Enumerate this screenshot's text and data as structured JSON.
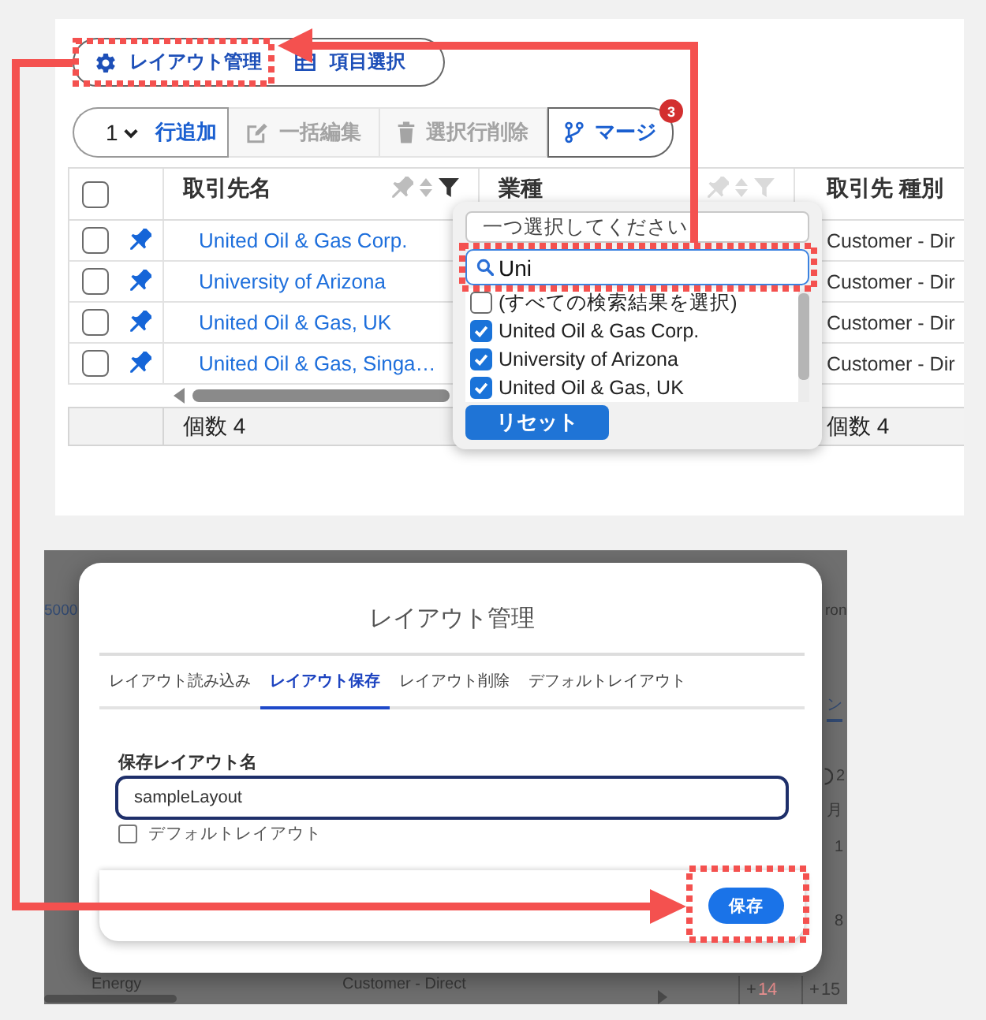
{
  "top_screen": {
    "view_buttons": [
      {
        "label": "レイアウト管理",
        "kind": "layout"
      },
      {
        "label": "項目選択",
        "kind": "columns"
      }
    ],
    "toolbar": {
      "add_count": "1",
      "buttons": [
        {
          "label": "行追加",
          "kind": "add",
          "disabled": false
        },
        {
          "label": "一括編集",
          "kind": "edit",
          "disabled": true
        },
        {
          "label": "選択行削除",
          "kind": "delete",
          "disabled": true
        },
        {
          "label": "マージ",
          "kind": "merge",
          "disabled": false,
          "badge": "3"
        }
      ]
    },
    "table": {
      "select_all_checked": false,
      "columns": [
        {
          "label": "取引先名",
          "filtered": true
        },
        {
          "label": "業種",
          "filtered": false
        },
        {
          "label": "取引先 種別"
        }
      ],
      "rows": [
        {
          "checked": false,
          "pinned": true,
          "account_name": "United Oil & Gas Corp.",
          "account_type": "Customer - Dir"
        },
        {
          "checked": false,
          "pinned": true,
          "account_name": "University of Arizona",
          "account_type": "Customer - Dir"
        },
        {
          "checked": false,
          "pinned": true,
          "account_name": "United Oil & Gas, UK",
          "account_type": "Customer - Dir"
        },
        {
          "checked": false,
          "pinned": true,
          "account_name": "United Oil & Gas, Singa…",
          "account_type": "Customer - Dir"
        }
      ],
      "footer": {
        "account_name": "個数 4",
        "account_type": "個数 4"
      }
    },
    "filter_popup": {
      "select": {
        "placeholder": "一つ選択してください"
      },
      "search": {
        "value": "Uni"
      },
      "options": [
        {
          "label": "(すべての検索結果を選択)",
          "checked": false
        },
        {
          "label": "United Oil & Gas Corp.",
          "checked": true
        },
        {
          "label": "University of Arizona",
          "checked": true
        },
        {
          "label": "United Oil & Gas, UK",
          "checked": true
        }
      ],
      "reset_label": "リセット"
    }
  },
  "bottom_screen": {
    "background": {
      "texts": [
        {
          "text": "5000",
          "kind": "link"
        },
        {
          "text": "ron",
          "kind": "plain"
        },
        {
          "text": "ン",
          "kind": "tab"
        },
        {
          "text": "2",
          "kind": "plain"
        },
        {
          "text": "月",
          "kind": "plain"
        },
        {
          "text": "1",
          "kind": "plain"
        },
        {
          "text": "8",
          "kind": "plain"
        },
        {
          "text": "Energy",
          "kind": "plain"
        },
        {
          "text": "Customer - Direct",
          "kind": "plain"
        }
      ],
      "cells": [
        {
          "sign": "+",
          "number": "14",
          "color": "#f29494"
        },
        {
          "sign": "+",
          "number": "15",
          "color": "#3c3c3c"
        }
      ]
    },
    "modal": {
      "title": "レイアウト管理",
      "tabs": [
        {
          "label": "レイアウト読み込み",
          "selected": false
        },
        {
          "label": "レイアウト保存",
          "selected": true
        },
        {
          "label": "レイアウト削除",
          "selected": false
        },
        {
          "label": "デフォルトレイアウト",
          "selected": false
        }
      ],
      "name_field": {
        "label": "保存レイアウト名",
        "value": "sampleLayout"
      },
      "default_checkbox": {
        "label": "デフォルトレイアウト",
        "checked": false
      },
      "save_label": "保存"
    }
  }
}
